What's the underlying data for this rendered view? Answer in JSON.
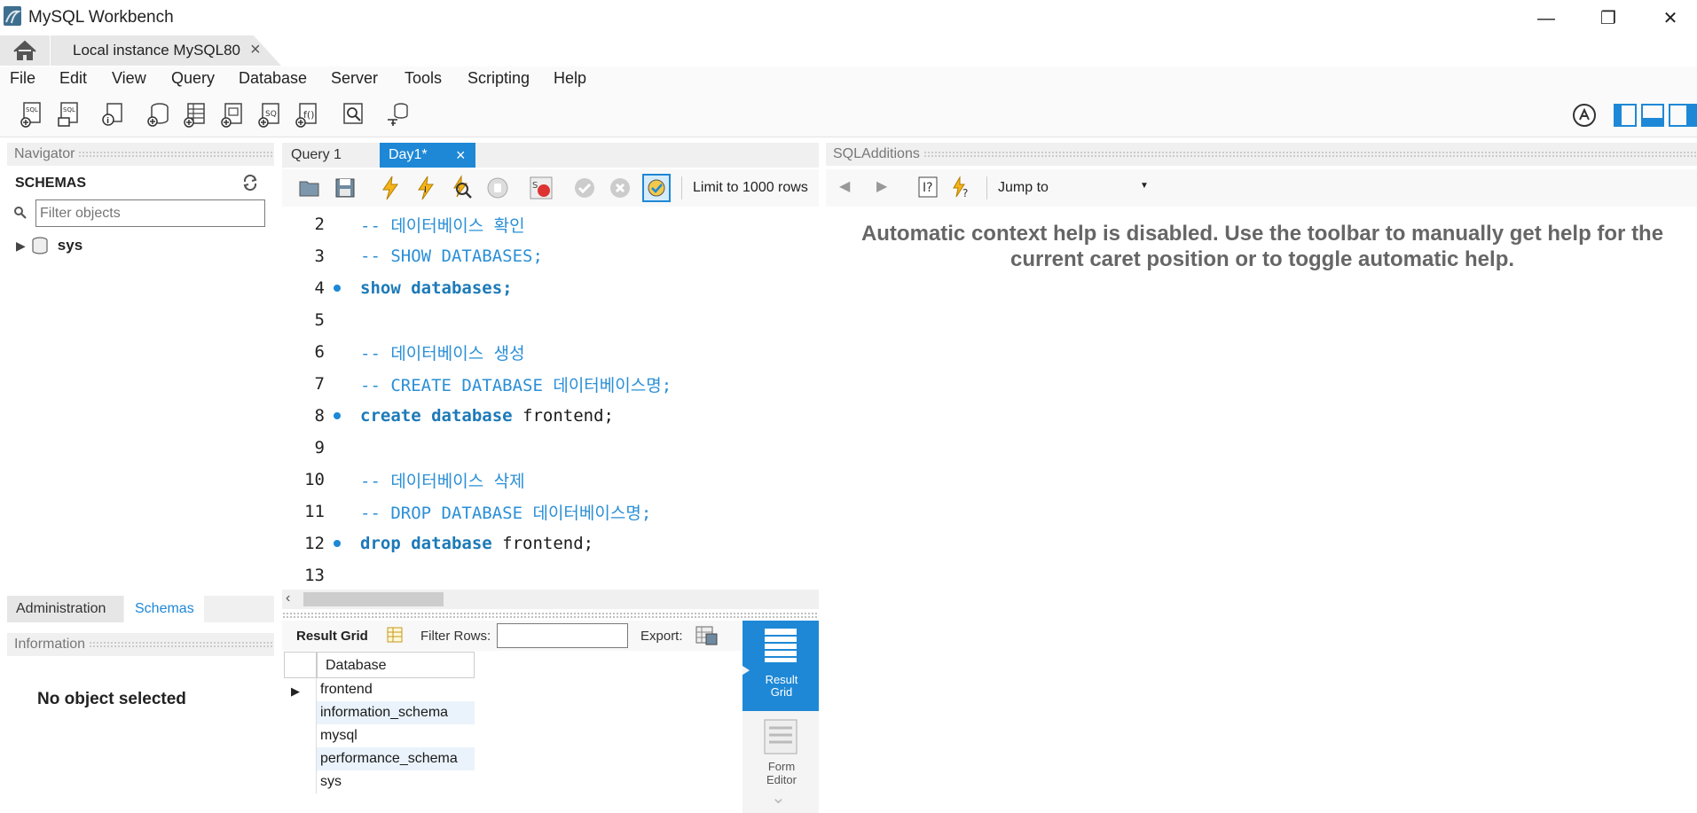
{
  "window": {
    "title": "MySQL Workbench",
    "minimize": "—",
    "restore": "❐",
    "close": "✕"
  },
  "tabs": {
    "connection": "Local instance MySQL80",
    "close": "×"
  },
  "menu": [
    "File",
    "Edit",
    "View",
    "Query",
    "Database",
    "Server",
    "Tools",
    "Scripting",
    "Help"
  ],
  "navigator": {
    "title": "Navigator",
    "schemas_title": "SCHEMAS",
    "filter_placeholder": "Filter objects",
    "tree": [
      {
        "name": "sys"
      }
    ],
    "bottom_tabs": [
      "Administration",
      "Schemas"
    ],
    "info_title": "Information",
    "no_object": "No object selected"
  },
  "editor": {
    "tabs": [
      {
        "label": "Query 1"
      },
      {
        "label": "Day1*"
      }
    ],
    "tab_close": "×",
    "limit_label": "Limit to 1000 rows",
    "lines": [
      {
        "num": "2",
        "dot": false,
        "parts": [
          {
            "t": "-- 데이터베이스 확인",
            "c": "cmt"
          }
        ]
      },
      {
        "num": "3",
        "dot": false,
        "parts": [
          {
            "t": "-- SHOW DATABASES;",
            "c": "cmt"
          }
        ]
      },
      {
        "num": "4",
        "dot": true,
        "parts": [
          {
            "t": "show databases",
            "c": "kw"
          },
          {
            "t": ";",
            "c": "kw"
          }
        ]
      },
      {
        "num": "5",
        "dot": false,
        "parts": []
      },
      {
        "num": "6",
        "dot": false,
        "parts": [
          {
            "t": "-- 데이터베이스 생성",
            "c": "cmt"
          }
        ]
      },
      {
        "num": "7",
        "dot": false,
        "parts": [
          {
            "t": "-- CREATE DATABASE 데이터베이스명;",
            "c": "cmt"
          }
        ]
      },
      {
        "num": "8",
        "dot": true,
        "parts": [
          {
            "t": "create database ",
            "c": "kw"
          },
          {
            "t": "frontend;",
            "c": "id"
          }
        ]
      },
      {
        "num": "9",
        "dot": false,
        "parts": []
      },
      {
        "num": "10",
        "dot": false,
        "parts": [
          {
            "t": "-- 데이터베이스 삭제",
            "c": "cmt"
          }
        ]
      },
      {
        "num": "11",
        "dot": false,
        "parts": [
          {
            "t": "-- DROP DATABASE 데이터베이스명;",
            "c": "cmt"
          }
        ]
      },
      {
        "num": "12",
        "dot": true,
        "parts": [
          {
            "t": "drop database ",
            "c": "kw"
          },
          {
            "t": "frontend;",
            "c": "id"
          }
        ]
      },
      {
        "num": "13",
        "dot": false,
        "parts": []
      }
    ]
  },
  "results": {
    "result_grid_label": "Result Grid",
    "filter_rows_label": "Filter Rows:",
    "export_label": "Export:",
    "column": "Database",
    "rows": [
      "frontend",
      "information_schema",
      "mysql",
      "performance_schema",
      "sys"
    ],
    "side_result_grid": "Result Grid",
    "side_form_editor": "Form Editor"
  },
  "sql_additions": {
    "title": "SQLAdditions",
    "jump_to": "Jump to",
    "help_text": "Automatic context help is disabled. Use the toolbar to manually get help for the current caret position or to toggle automatic help."
  },
  "icons": {
    "accent": "#1e88d6",
    "editor_tab_active": "#1e88d6",
    "result_side_active": "#1e88d6"
  }
}
